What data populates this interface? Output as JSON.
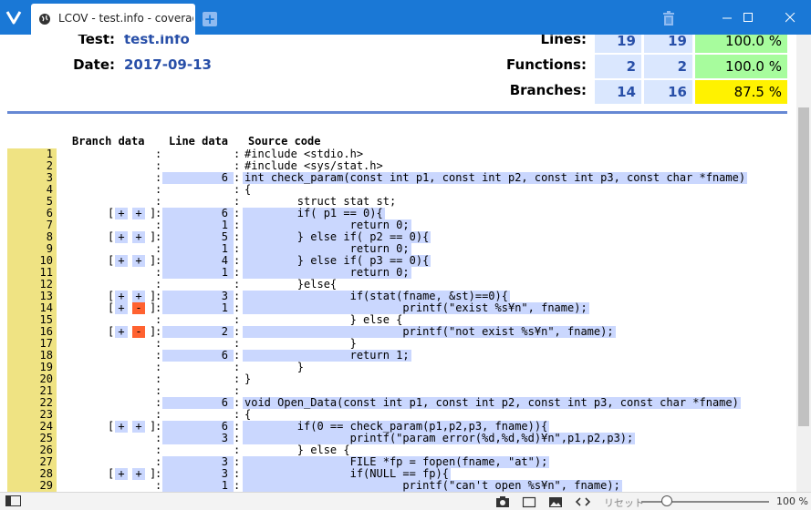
{
  "window": {
    "tab_title": "LCOV - test.info - coverage/t",
    "icons": {
      "app": "vivaldi-logo-icon",
      "favicon": "globe-icon",
      "new_tab": "plus-icon",
      "trash": "trash-icon"
    }
  },
  "summary": {
    "test_label": "Test:",
    "test_value": "test.info",
    "date_label": "Date:",
    "date_value": "2017-09-13",
    "stats": [
      {
        "label": "Lines:",
        "hit": "19",
        "total": "19",
        "percent": "100.0 %",
        "color": "#a7fc9d"
      },
      {
        "label": "Functions:",
        "hit": "2",
        "total": "2",
        "percent": "100.0 %",
        "color": "#a7fc9d"
      },
      {
        "label": "Branches:",
        "hit": "14",
        "total": "16",
        "percent": "87.5 %",
        "color": "#fff200"
      }
    ]
  },
  "table": {
    "branch_header": "Branch data",
    "line_header": "Line data",
    "source_header": "Source code",
    "lines": [
      {
        "n": "1",
        "branches": [],
        "count": "",
        "code": "#include <stdio.h>"
      },
      {
        "n": "2",
        "branches": [],
        "count": "",
        "code": "#include <sys/stat.h>"
      },
      {
        "n": "3",
        "branches": [],
        "count": "6",
        "code": "int check_param(const int p1, const int p2, const int p3, const char *fname)"
      },
      {
        "n": "4",
        "branches": [],
        "count": "",
        "code": "{"
      },
      {
        "n": "5",
        "branches": [],
        "count": "",
        "code": "        struct stat st;"
      },
      {
        "n": "6",
        "branches": [
          "+",
          "+"
        ],
        "count": "6",
        "code": "        if( p1 == 0){"
      },
      {
        "n": "7",
        "branches": [],
        "count": "1",
        "code": "                return 0;"
      },
      {
        "n": "8",
        "branches": [
          "+",
          "+"
        ],
        "count": "5",
        "code": "        } else if( p2 == 0){"
      },
      {
        "n": "9",
        "branches": [],
        "count": "1",
        "code": "                return 0;"
      },
      {
        "n": "10",
        "branches": [
          "+",
          "+"
        ],
        "count": "4",
        "code": "        } else if( p3 == 0){"
      },
      {
        "n": "11",
        "branches": [],
        "count": "1",
        "code": "                return 0;"
      },
      {
        "n": "12",
        "branches": [],
        "count": "",
        "code": "        }else{"
      },
      {
        "n": "13",
        "branches": [
          "+",
          "+"
        ],
        "count": "3",
        "code": "                if(stat(fname, &st)==0){"
      },
      {
        "n": "14",
        "branches": [
          "+",
          "-"
        ],
        "count": "1",
        "code": "                        printf(\"exist %s¥n\", fname);"
      },
      {
        "n": "15",
        "branches": [],
        "count": "",
        "code": "                } else {"
      },
      {
        "n": "16",
        "branches": [
          "+",
          "-"
        ],
        "count": "2",
        "code": "                        printf(\"not exist %s¥n\", fname);"
      },
      {
        "n": "17",
        "branches": [],
        "count": "",
        "code": "                }"
      },
      {
        "n": "18",
        "branches": [],
        "count": "6",
        "code": "                return 1;"
      },
      {
        "n": "19",
        "branches": [],
        "count": "",
        "code": "        }"
      },
      {
        "n": "20",
        "branches": [],
        "count": "",
        "code": "}"
      },
      {
        "n": "21",
        "branches": [],
        "count": "",
        "code": ""
      },
      {
        "n": "22",
        "branches": [],
        "count": "6",
        "code": "void Open_Data(const int p1, const int p2, const int p3, const char *fname)"
      },
      {
        "n": "23",
        "branches": [],
        "count": "",
        "code": "{"
      },
      {
        "n": "24",
        "branches": [
          "+",
          "+"
        ],
        "count": "6",
        "code": "        if(0 == check_param(p1,p2,p3, fname)){"
      },
      {
        "n": "25",
        "branches": [],
        "count": "3",
        "code": "                printf(\"param error(%d,%d,%d)¥n\",p1,p2,p3);"
      },
      {
        "n": "26",
        "branches": [],
        "count": "",
        "code": "        } else {"
      },
      {
        "n": "27",
        "branches": [],
        "count": "3",
        "code": "                FILE *fp = fopen(fname, \"at\");"
      },
      {
        "n": "28",
        "branches": [
          "+",
          "+"
        ],
        "count": "3",
        "code": "                if(NULL == fp){"
      },
      {
        "n": "29",
        "branches": [],
        "count": "1",
        "code": "                        printf(\"can't open %s¥n\", fname);"
      }
    ]
  },
  "statusbar": {
    "reset_label": "リセット",
    "zoom": "100 %",
    "zoom_level": 0.2,
    "icons": [
      "panel-toggle-icon",
      "camera-icon",
      "window-icon",
      "image-icon",
      "code-icon"
    ]
  }
}
